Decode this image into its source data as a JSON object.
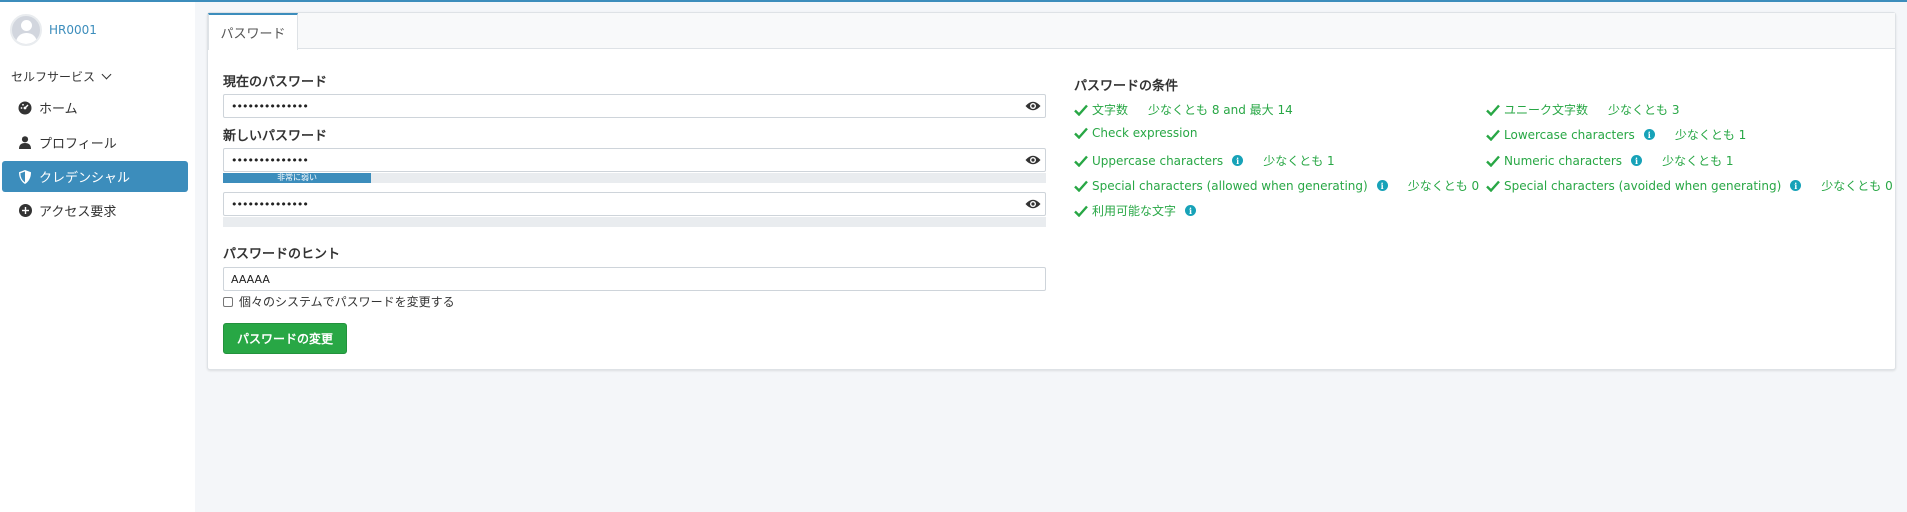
{
  "user": {
    "name": "HR0001"
  },
  "sidebar": {
    "section": "セルフサービス",
    "items": [
      {
        "label": "ホーム",
        "icon": "dashboard-icon",
        "active": false
      },
      {
        "label": "プロフィール",
        "icon": "user-icon",
        "active": false
      },
      {
        "label": "クレデンシャル",
        "icon": "shield-icon",
        "active": true
      },
      {
        "label": "アクセス要求",
        "icon": "plus-circle-icon",
        "active": false
      }
    ]
  },
  "tab": {
    "label": "パスワード"
  },
  "form": {
    "current_label": "現在のパスワード",
    "current_value": "••••••••••••••",
    "new_label": "新しいパスワード",
    "new_value": "••••••••••••••",
    "strength_text": "非常に弱い",
    "strength_percent": 18,
    "confirm_value": "••••••••••••••",
    "hint_label": "パスワードのヒント",
    "hint_value": "AAAAA",
    "individual_label": "個々のシステムでパスワードを変更する",
    "submit_label": "パスワードの変更"
  },
  "conditions": {
    "title": "パスワードの条件",
    "items": [
      {
        "label": "文字数",
        "value": "少なくとも 8 and 最大 14",
        "info": false
      },
      {
        "label": "ユニーク文字数",
        "value": "少なくとも 3",
        "info": false
      },
      {
        "label": "Check expression",
        "value": "",
        "info": false
      },
      {
        "label": "Lowercase characters",
        "value": "少なくとも 1",
        "info": true
      },
      {
        "label": "Uppercase characters",
        "value": "少なくとも 1",
        "info": true
      },
      {
        "label": "Numeric characters",
        "value": "少なくとも 1",
        "info": true
      },
      {
        "label": "Special characters (allowed when generating)",
        "value": "少なくとも 0",
        "info": true
      },
      {
        "label": "Special characters (avoided when generating)",
        "value": "少なくとも 0",
        "info": true
      },
      {
        "label": "利用可能な文字",
        "value": "",
        "info": true
      }
    ]
  },
  "colors": {
    "primary": "#3c8dbc",
    "success": "#28a745",
    "info": "#17a2b8"
  }
}
